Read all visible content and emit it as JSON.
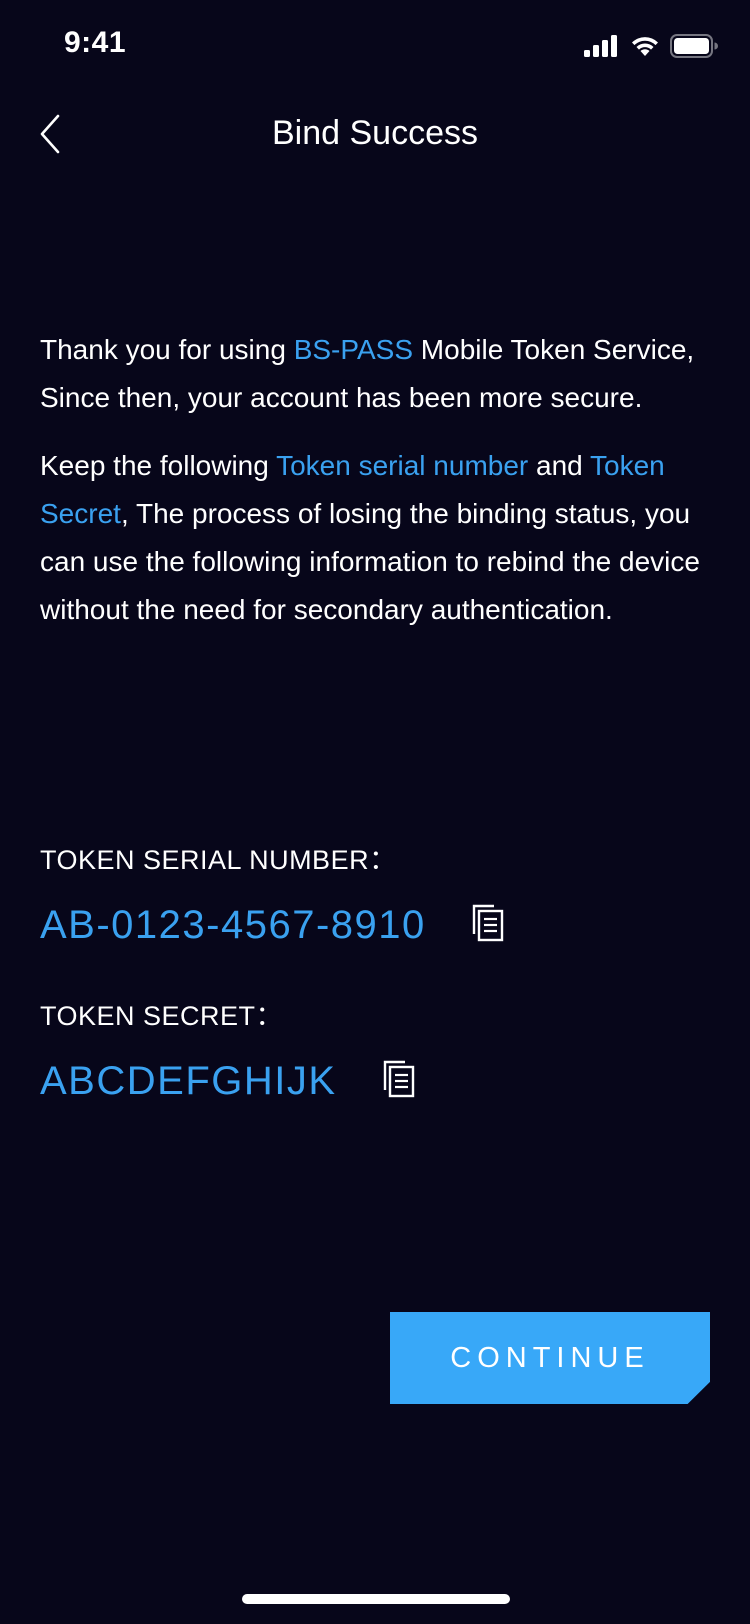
{
  "status_bar": {
    "time": "9:41",
    "icons": [
      "cellular-signal-icon",
      "wifi-icon",
      "battery-icon"
    ]
  },
  "nav": {
    "title": "Bind Success",
    "back_icon": "chevron-left-icon"
  },
  "intro": {
    "p1_part1": "Thank you for using ",
    "p1_brand": "BS-PASS",
    "p1_part2": " Mobile Token Service, Since then, your account has been more secure.",
    "p2_part1": "Keep the following ",
    "p2_highlight1": "Token serial number",
    "p2_part2": " and ",
    "p2_highlight2": "Token Secret",
    "p2_part3": ", The process of losing the binding status, you can use the following information to rebind the device without the need for secondary authentication."
  },
  "token_serial": {
    "label": "TOKEN SERIAL NUMBER：",
    "value": "AB-0123-4567-8910",
    "copy_icon": "copy-icon"
  },
  "token_secret": {
    "label": "TOKEN SECRET：",
    "value": "ABCDEFGHIJK",
    "copy_icon": "copy-icon"
  },
  "actions": {
    "continue_label": "CONTINUE"
  },
  "colors": {
    "background": "#07061a",
    "accent": "#3aa1f0",
    "button": "#38a8f8",
    "text": "#ffffff"
  }
}
